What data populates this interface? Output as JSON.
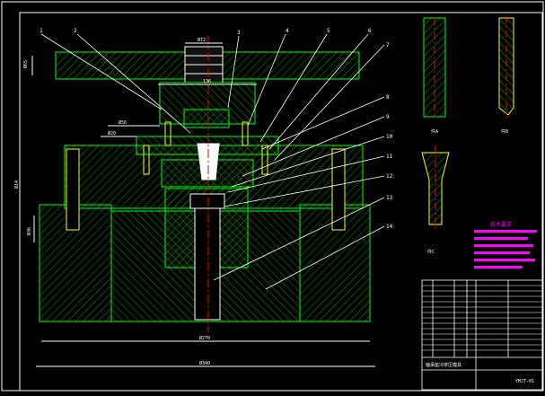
{
  "callouts": [
    "1",
    "2",
    "3",
    "4",
    "5",
    "6",
    "7",
    "8",
    "9",
    "10",
    "11",
    "12",
    "13",
    "14"
  ],
  "dimensions": {
    "top_width": "Ø72",
    "mid_width": "136",
    "upper_left": "Ø56",
    "left_offset": "Ø20",
    "left_height_top": "Ø65",
    "left_height_main": "Ø14",
    "base_width": "Ø270",
    "base_total": "Ø340",
    "slot_width": "Ø36"
  },
  "part_labels": {
    "pin_view": "件A",
    "rod_view": "件B",
    "punch_view": "件C"
  },
  "tech": {
    "title": "技术要求",
    "lines": 6
  },
  "title_block": {
    "title": "轴承座冷挤压模具",
    "drawing_no": "YMJT-01"
  },
  "colors": {
    "green": "#00ff00",
    "yellow": "#ffff00",
    "white": "#ffffff",
    "red": "#ff0000",
    "magenta": "#ff00ff",
    "cyan": "#00ffff"
  }
}
